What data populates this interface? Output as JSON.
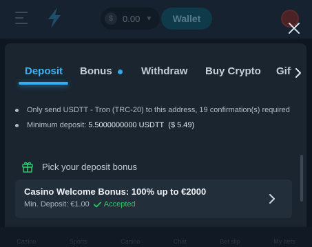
{
  "background": {
    "balance": "0.00",
    "wallet_label": "Wallet",
    "nav": [
      "Casino",
      "Sports",
      "Casino",
      "Chat",
      "Bet slip",
      "My bets"
    ]
  },
  "modal": {
    "tabs": [
      {
        "label": "Deposit",
        "active": true
      },
      {
        "label": "Bonus",
        "active": false,
        "badge": true
      },
      {
        "label": "Withdraw",
        "active": false
      },
      {
        "label": "Buy Crypto",
        "active": false
      },
      {
        "label": "Gift",
        "active": false
      }
    ],
    "info": {
      "line1": "Only send USDTT - Tron (TRC-20) to this address, 19 confirmation(s) required",
      "line2_prefix": "Minimum deposit:",
      "line2_amount": "5.5000000000 USDTT",
      "line2_fiat": "($ 5.49)"
    },
    "bonus_heading": "Pick your deposit bonus",
    "bonus_card": {
      "title": "Casino Welcome Bonus: 100% up to €2000",
      "min_deposit": "Min. Deposit: €1.00",
      "status": "Accepted"
    }
  },
  "colors": {
    "accent": "#37aef0",
    "success": "#2fc46a",
    "modal_bg": "#1a2530",
    "card_bg": "#222e3a"
  },
  "icons": [
    "menu-icon",
    "logo-bolt-icon",
    "coin-icon",
    "close-icon",
    "chevron-right-icon",
    "gift-icon",
    "check-icon"
  ]
}
